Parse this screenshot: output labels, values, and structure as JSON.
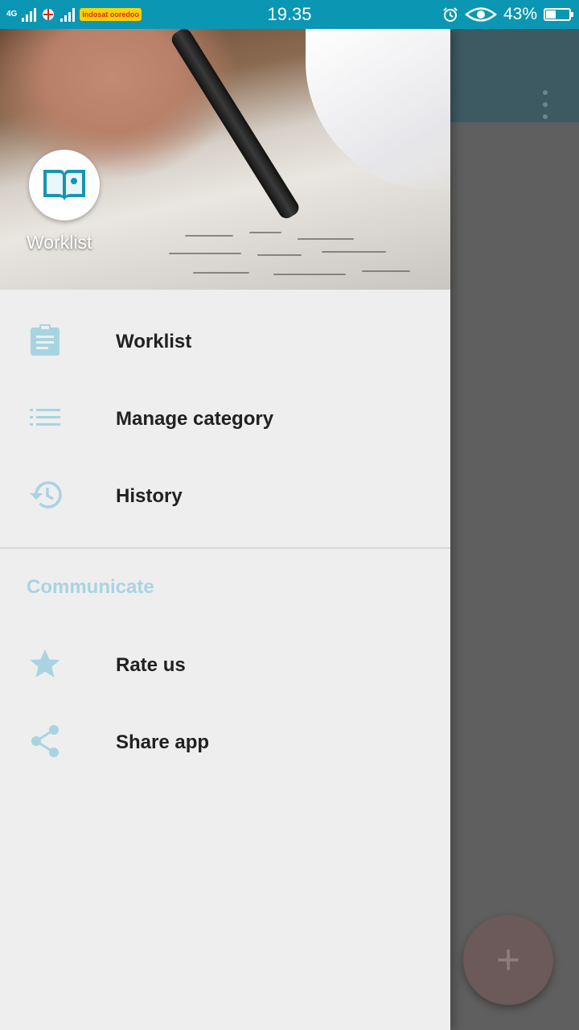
{
  "status_bar": {
    "network_type": "4G",
    "operator": "indosat ooredoo",
    "time": "19.35",
    "battery_percent": "43%",
    "battery_level": 0.43
  },
  "app": {
    "fab_label": "+"
  },
  "drawer": {
    "header_title": "Worklist",
    "items": [
      {
        "label": "Worklist",
        "icon": "clipboard-icon"
      },
      {
        "label": "Manage category",
        "icon": "list-icon"
      },
      {
        "label": "History",
        "icon": "history-icon"
      }
    ],
    "section_title": "Communicate",
    "section_items": [
      {
        "label": "Rate us",
        "icon": "star-icon"
      },
      {
        "label": "Share app",
        "icon": "share-icon"
      }
    ]
  },
  "colors": {
    "status_bar": "#0b97b3",
    "icon_tint": "#a8d4e2",
    "app_logo": "#1594b8"
  }
}
